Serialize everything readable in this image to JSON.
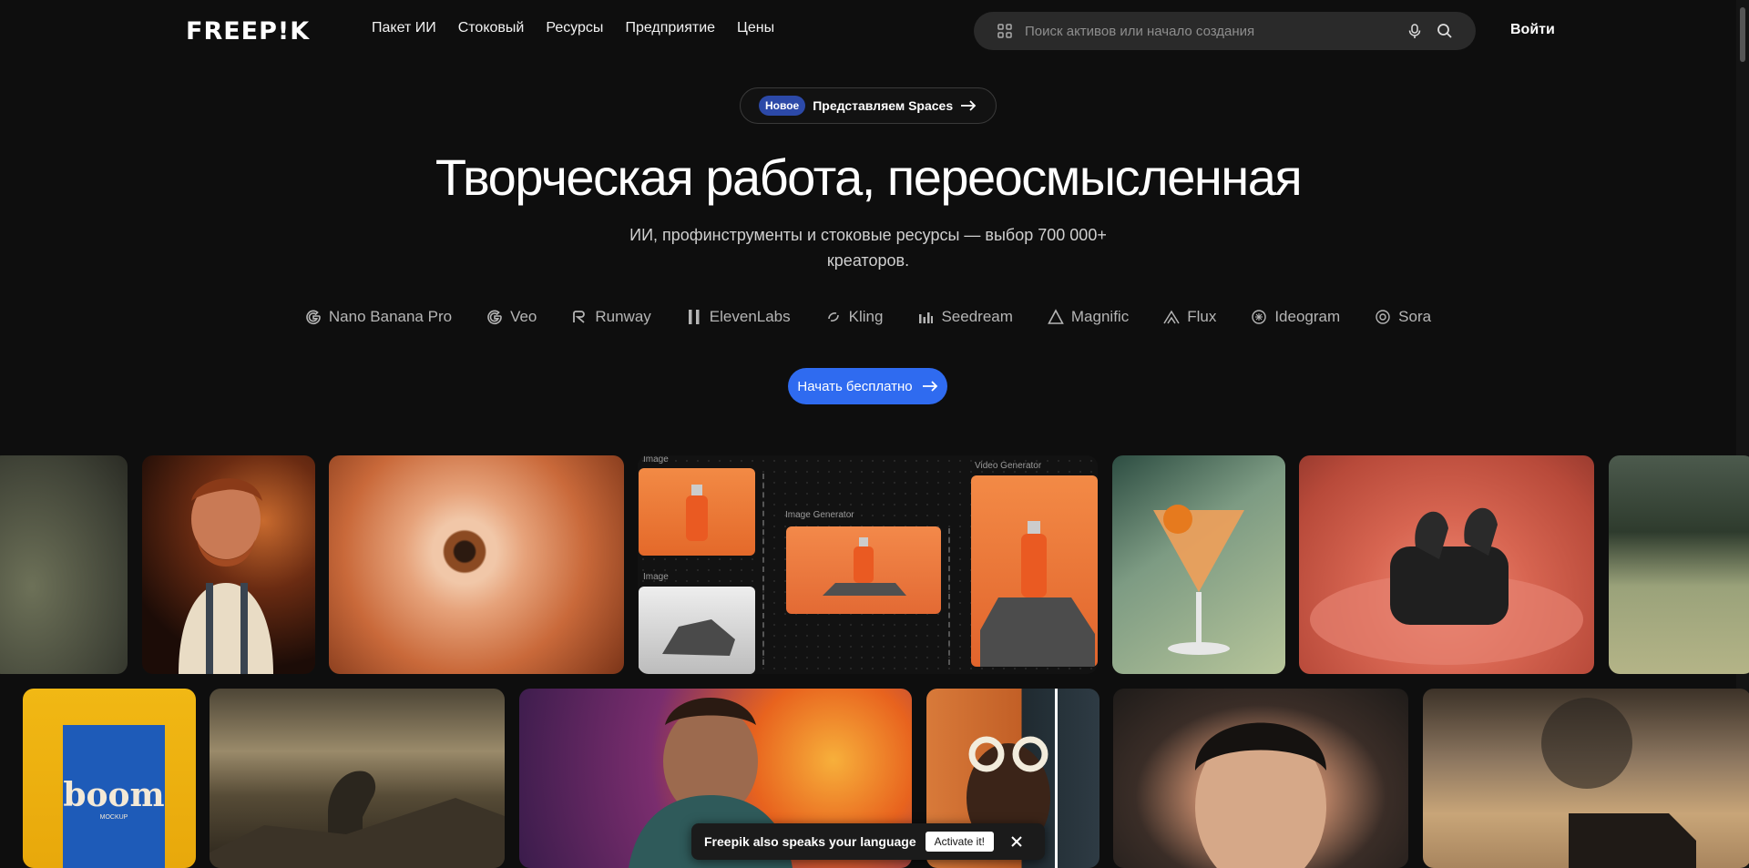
{
  "header": {
    "logo": "FREEP!K",
    "nav": [
      "Пакет ИИ",
      "Стоковый",
      "Ресурсы",
      "Предприятие",
      "Цены"
    ],
    "search_placeholder": "Поиск активов или начало создания",
    "login_label": "Войти"
  },
  "announcement": {
    "badge": "Новое",
    "text": "Представляем Spaces"
  },
  "hero": {
    "title": "Творческая работа, переосмысленная",
    "subtitle": "ИИ, профинструменты и стоковые ресурсы — выбор 700 000+ креаторов.",
    "cta_label": "Начать бесплатно"
  },
  "models": [
    {
      "name": "Nano Banana Pro",
      "icon": "google-icon"
    },
    {
      "name": "Veo",
      "icon": "google-icon"
    },
    {
      "name": "Runway",
      "icon": "runway-icon"
    },
    {
      "name": "ElevenLabs",
      "icon": "elevenlabs-icon"
    },
    {
      "name": "Kling",
      "icon": "kling-icon"
    },
    {
      "name": "Seedream",
      "icon": "seedream-icon"
    },
    {
      "name": "Magnific",
      "icon": "magnific-icon"
    },
    {
      "name": "Flux",
      "icon": "flux-icon"
    },
    {
      "name": "Ideogram",
      "icon": "ideogram-icon"
    },
    {
      "name": "Sora",
      "icon": "openai-icon"
    }
  ],
  "node_editor": {
    "image_label_1": "Image",
    "image_label_2": "Image",
    "generator_label": "Image Generator",
    "video_label": "Video Generator"
  },
  "mockup_text": "boom",
  "mockup_sub": "MOCKUP",
  "toast": {
    "text": "Freepik also speaks your language",
    "button_label": "Activate it!"
  },
  "colors": {
    "background": "#0e0e0e",
    "accent": "#2f6bf0",
    "badge": "#2c49a8"
  }
}
